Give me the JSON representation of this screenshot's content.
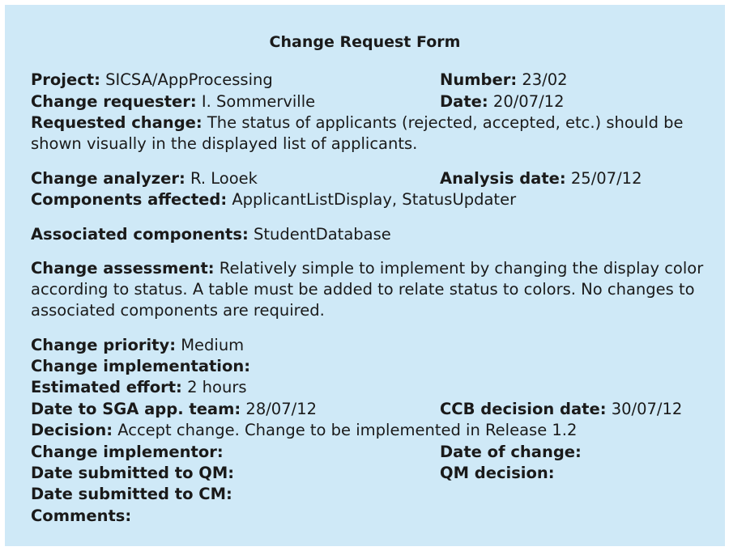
{
  "title": "Change Request Form",
  "project": {
    "label": "Project:",
    "value": "SICSA/AppProcessing"
  },
  "number": {
    "label": "Number:",
    "value": "23/02"
  },
  "change_requester": {
    "label": "Change requester:",
    "value": "I. Sommerville"
  },
  "date": {
    "label": "Date:",
    "value": "20/07/12"
  },
  "requested_change": {
    "label": "Requested change:",
    "value": "The status of applicants (rejected, accepted, etc.) should be shown visually in the displayed list of applicants."
  },
  "change_analyzer": {
    "label": "Change analyzer:",
    "value": "R. Looek"
  },
  "analysis_date": {
    "label": "Analysis date:",
    "value": "25/07/12"
  },
  "components_affected": {
    "label": "Components affected:",
    "value": "ApplicantListDisplay, StatusUpdater"
  },
  "associated_components": {
    "label": "Associated components:",
    "value": "StudentDatabase"
  },
  "change_assessment": {
    "label": "Change assessment:",
    "value": "Relatively simple to implement by changing the display color according to status. A table must be added to relate status to colors. No changes to associated components are required."
  },
  "change_priority": {
    "label": "Change priority:",
    "value": "Medium"
  },
  "change_implementation": {
    "label": "Change implementation:",
    "value": ""
  },
  "estimated_effort": {
    "label": "Estimated effort:",
    "value": "2 hours"
  },
  "date_to_sga": {
    "label": "Date to SGA app. team:",
    "value": "28/07/12"
  },
  "ccb_decision_date": {
    "label": "CCB decision date:",
    "value": "30/07/12"
  },
  "decision": {
    "label": "Decision:",
    "value": "Accept change. Change to be implemented in Release 1.2"
  },
  "change_implementor": {
    "label": "Change implementor:",
    "value": ""
  },
  "date_of_change": {
    "label": "Date of change:",
    "value": ""
  },
  "date_submitted_qm": {
    "label": "Date submitted to QM:",
    "value": ""
  },
  "qm_decision": {
    "label": "QM decision:",
    "value": ""
  },
  "date_submitted_cm": {
    "label": "Date submitted to CM:",
    "value": ""
  },
  "comments": {
    "label": "Comments:",
    "value": ""
  }
}
